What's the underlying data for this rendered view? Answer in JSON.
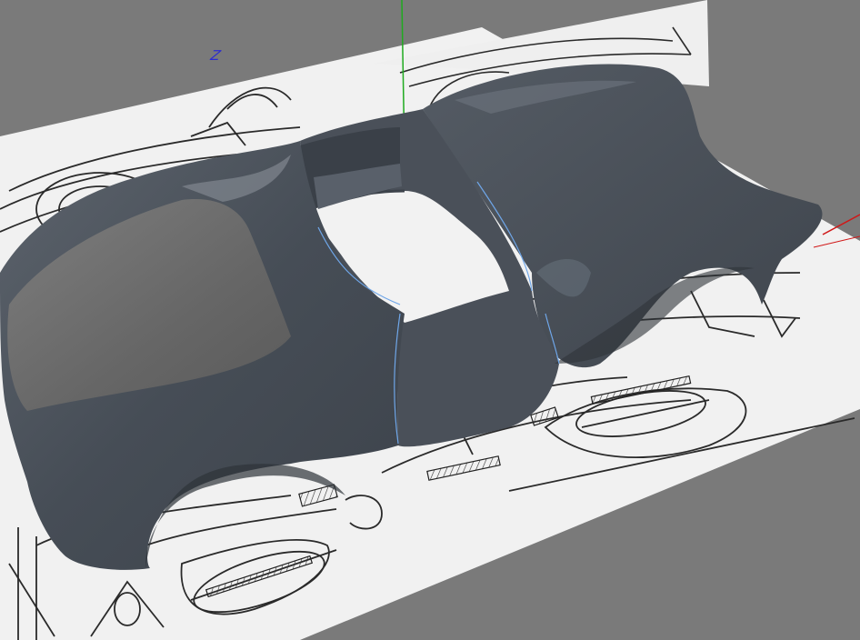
{
  "viewport": {
    "axis_label": "Z",
    "colors": {
      "background": "#7a7a7a",
      "blueprint_paper": "#f2f2f2",
      "body_shell": "#4b525b",
      "x_axis": "#d01818",
      "y_axis": "#1faa1f",
      "z_axis": "#2b2bd0"
    },
    "blueprint_dims": [
      "2300",
      "5"
    ]
  }
}
